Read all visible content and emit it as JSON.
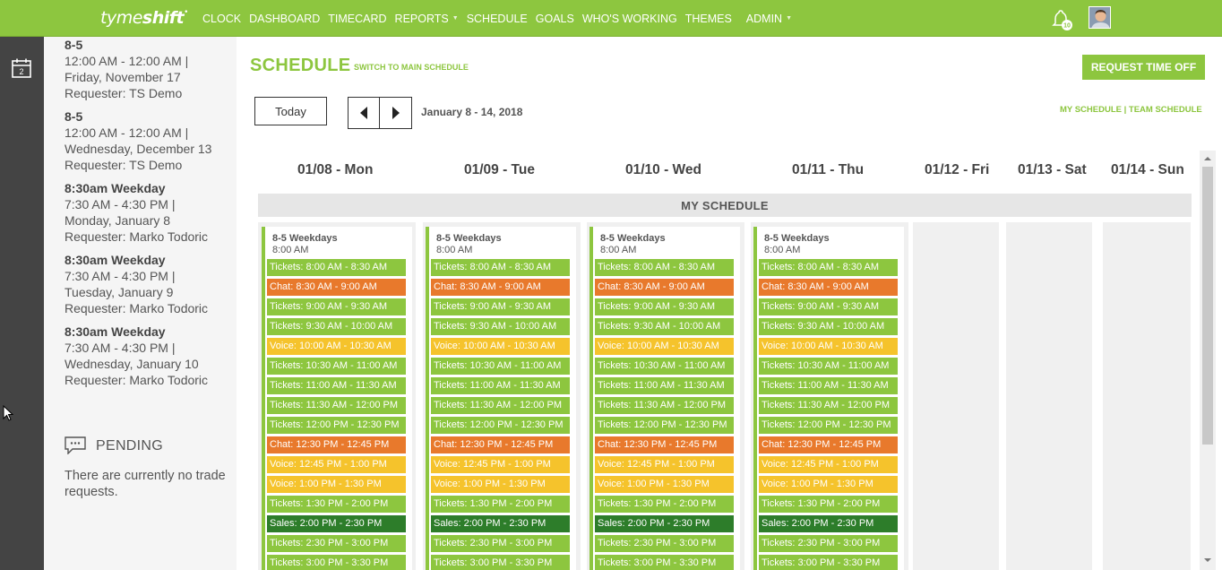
{
  "brand": {
    "name_light": "tyme",
    "name_bold": "shift"
  },
  "nav": [
    {
      "label": "CLOCK"
    },
    {
      "label": "DASHBOARD"
    },
    {
      "label": "TIMECARD"
    },
    {
      "label": "REPORTS",
      "has_caret": true
    },
    {
      "label": "SCHEDULE"
    },
    {
      "label": "GOALS"
    },
    {
      "label": "WHO'S WORKING"
    },
    {
      "label": "THEMES"
    },
    {
      "label": "ADMIN",
      "has_caret": true
    }
  ],
  "notifications": {
    "count": "10"
  },
  "requests": [
    {
      "name": "8-5",
      "line1": "12:00 AM - 12:00 AM |",
      "line2": "Friday, November 17",
      "line3": "Requester: TS Demo"
    },
    {
      "name": "8-5",
      "line1": "12:00 AM - 12:00 AM |",
      "line2": "Wednesday, December 13",
      "line3": "Requester: TS Demo"
    },
    {
      "name": "8:30am Weekday",
      "line1": "7:30 AM - 4:30 PM |",
      "line2": "Monday, January 8",
      "line3": "Requester: Marko Todoric"
    },
    {
      "name": "8:30am Weekday",
      "line1": "7:30 AM - 4:30 PM |",
      "line2": "Tuesday, January 9",
      "line3": "Requester: Marko Todoric"
    },
    {
      "name": "8:30am Weekday",
      "line1": "7:30 AM - 4:30 PM |",
      "line2": "Wednesday, January 10",
      "line3": "Requester: Marko Todoric"
    }
  ],
  "pending": {
    "title": "PENDING",
    "text": "There are currently no trade requests."
  },
  "schedule": {
    "title": "SCHEDULE",
    "switch_link": "SWITCH TO MAIN SCHEDULE",
    "request_time_off": "REQUEST TIME OFF",
    "today": "Today",
    "date_range": "January 8 - 14, 2018",
    "view_my": "MY SCHEDULE",
    "view_sep": " | ",
    "view_team": "TEAM SCHEDULE",
    "section_title": "MY SCHEDULE"
  },
  "days": [
    {
      "label": "01/08 - Mon"
    },
    {
      "label": "01/09 - Tue"
    },
    {
      "label": "01/10 - Wed"
    },
    {
      "label": "01/11 - Thu"
    },
    {
      "label": "01/12 - Fri"
    },
    {
      "label": "01/13 - Sat"
    },
    {
      "label": "01/14 - Sun"
    }
  ],
  "shift": {
    "title": "8-5 Weekdays",
    "start": "8:00 AM"
  },
  "slots": {
    "mon": [
      {
        "type": "tickets",
        "label": "Tickets: 8:00 AM - 8:30 AM"
      },
      {
        "type": "chat",
        "label": "Chat: 8:30 AM - 9:00 AM"
      },
      {
        "type": "tickets",
        "label": "Tickets: 9:00 AM - 9:30 AM"
      },
      {
        "type": "tickets",
        "label": "Tickets: 9:30 AM - 10:00 AM"
      },
      {
        "type": "voice",
        "label": "Voice: 10:00 AM - 10:30 AM"
      },
      {
        "type": "tickets",
        "label": "Tickets: 10:30 AM - 11:00 AM"
      },
      {
        "type": "tickets",
        "label": "Tickets: 11:00 AM - 11:30 AM"
      },
      {
        "type": "tickets",
        "label": "Tickets: 11:30 AM - 12:00 PM"
      },
      {
        "type": "tickets",
        "label": "Tickets: 12:00 PM - 12:30 PM"
      },
      {
        "type": "chat",
        "label": "Chat: 12:30 PM - 12:45 PM"
      },
      {
        "type": "voice",
        "label": "Voice: 12:45 PM - 1:00 PM"
      },
      {
        "type": "voice",
        "label": "Voice: 1:00 PM - 1:30 PM"
      },
      {
        "type": "tickets",
        "label": "Tickets: 1:30 PM - 2:00 PM"
      },
      {
        "type": "sales",
        "label": "Sales: 2:00 PM - 2:30 PM"
      },
      {
        "type": "tickets",
        "label": "Tickets: 2:30 PM - 3:00 PM"
      },
      {
        "type": "tickets",
        "label": "Tickets: 3:00 PM - 3:30 PM"
      }
    ],
    "tue": [
      {
        "type": "tickets",
        "label": "Tickets: 8:00 AM - 8:30 AM"
      },
      {
        "type": "chat",
        "label": "Chat: 8:30 AM - 9:00 AM"
      },
      {
        "type": "tickets",
        "label": "Tickets: 9:00 AM - 9:30 AM"
      },
      {
        "type": "tickets",
        "label": "Tickets: 9:30 AM - 10:00 AM"
      },
      {
        "type": "voice",
        "label": "Voice: 10:00 AM - 10:30 AM"
      },
      {
        "type": "tickets",
        "label": "Tickets: 10:30 AM - 11:00 AM"
      },
      {
        "type": "tickets",
        "label": "Tickets: 11:00 AM - 11:30 AM"
      },
      {
        "type": "tickets",
        "label": "Tickets: 11:30 AM - 12:00 PM"
      },
      {
        "type": "tickets",
        "label": "Tickets: 12:00 PM - 12:30 PM"
      },
      {
        "type": "chat",
        "label": "Chat: 12:30 PM - 12:45 PM"
      },
      {
        "type": "voice",
        "label": "Voice: 12:45 PM - 1:00 PM"
      },
      {
        "type": "voice",
        "label": "Voice: 1:00 PM - 1:30 PM"
      },
      {
        "type": "tickets",
        "label": "Tickets: 1:30 PM - 2:00 PM"
      },
      {
        "type": "sales",
        "label": "Sales: 2:00 PM - 2:30 PM"
      },
      {
        "type": "tickets",
        "label": "Tickets: 2:30 PM - 3:00 PM"
      },
      {
        "type": "tickets",
        "label": "Tickets: 3:00 PM - 3:30 PM"
      }
    ],
    "wed": [
      {
        "type": "tickets",
        "label": "Tickets: 8:00 AM - 8:30 AM"
      },
      {
        "type": "chat",
        "label": "Chat: 8:30 AM - 9:00 AM"
      },
      {
        "type": "tickets",
        "label": "Tickets: 9:00 AM - 9:30 AM"
      },
      {
        "type": "tickets",
        "label": "Tickets: 9:30 AM - 10:00 AM"
      },
      {
        "type": "voice",
        "label": "Voice: 10:00 AM - 10:30 AM"
      },
      {
        "type": "tickets",
        "label": "Tickets: 10:30 AM - 11:00 AM"
      },
      {
        "type": "tickets",
        "label": "Tickets: 11:00 AM - 11:30 AM"
      },
      {
        "type": "tickets",
        "label": "Tickets: 11:30 AM - 12:00 PM"
      },
      {
        "type": "tickets",
        "label": "Tickets: 12:00 PM - 12:30 PM"
      },
      {
        "type": "chat",
        "label": "Chat: 12:30 PM - 12:45 PM"
      },
      {
        "type": "voice",
        "label": "Voice: 12:45 PM - 1:00 PM"
      },
      {
        "type": "voice",
        "label": "Voice: 1:00 PM - 1:30 PM"
      },
      {
        "type": "tickets",
        "label": "Tickets: 1:30 PM - 2:00 PM"
      },
      {
        "type": "sales",
        "label": "Sales: 2:00 PM - 2:30 PM"
      },
      {
        "type": "tickets",
        "label": "Tickets: 2:30 PM - 3:00 PM"
      },
      {
        "type": "tickets",
        "label": "Tickets: 3:00 PM - 3:30 PM"
      }
    ],
    "thu": [
      {
        "type": "tickets",
        "label": "Tickets: 8:00 AM - 8:30 AM"
      },
      {
        "type": "chat",
        "label": "Chat: 8:30 AM - 9:00 AM"
      },
      {
        "type": "tickets",
        "label": "Tickets: 9:00 AM - 9:30 AM"
      },
      {
        "type": "tickets",
        "label": "Tickets: 9:30 AM - 10:00 AM"
      },
      {
        "type": "voice",
        "label": "Voice: 10:00 AM - 10:30 AM"
      },
      {
        "type": "tickets",
        "label": "Tickets: 10:30 AM - 11:00 AM"
      },
      {
        "type": "tickets",
        "label": "Tickets: 11:00 AM - 11:30 AM"
      },
      {
        "type": "tickets",
        "label": "Tickets: 11:30 AM - 12:00 PM"
      },
      {
        "type": "tickets",
        "label": "Tickets: 12:00 PM - 12:30 PM"
      },
      {
        "type": "chat",
        "label": "Chat: 12:30 PM - 12:45 PM"
      },
      {
        "type": "voice",
        "label": "Voice: 12:45 PM - 1:00 PM"
      },
      {
        "type": "voice",
        "label": "Voice: 1:00 PM - 1:30 PM"
      },
      {
        "type": "tickets",
        "label": "Tickets: 1:30 PM - 2:00 PM"
      },
      {
        "type": "sales",
        "label": "Sales: 2:00 PM - 2:30 PM"
      },
      {
        "type": "tickets",
        "label": "Tickets: 2:30 PM - 3:00 PM"
      },
      {
        "type": "tickets",
        "label": "Tickets: 3:00 PM - 3:30 PM"
      }
    ]
  },
  "colors": {
    "brand_green": "#8dc63f",
    "chat_orange": "#e8792c",
    "voice_yellow": "#f5c32c",
    "sales_dark_green": "#2d7d2a",
    "rail_dark": "#444444"
  },
  "icons": {
    "bell": "bell-icon",
    "calendar": "calendar-icon",
    "chat_bubble": "chat-bubble-icon",
    "prev": "chevron-left-icon",
    "next": "chevron-right-icon"
  }
}
